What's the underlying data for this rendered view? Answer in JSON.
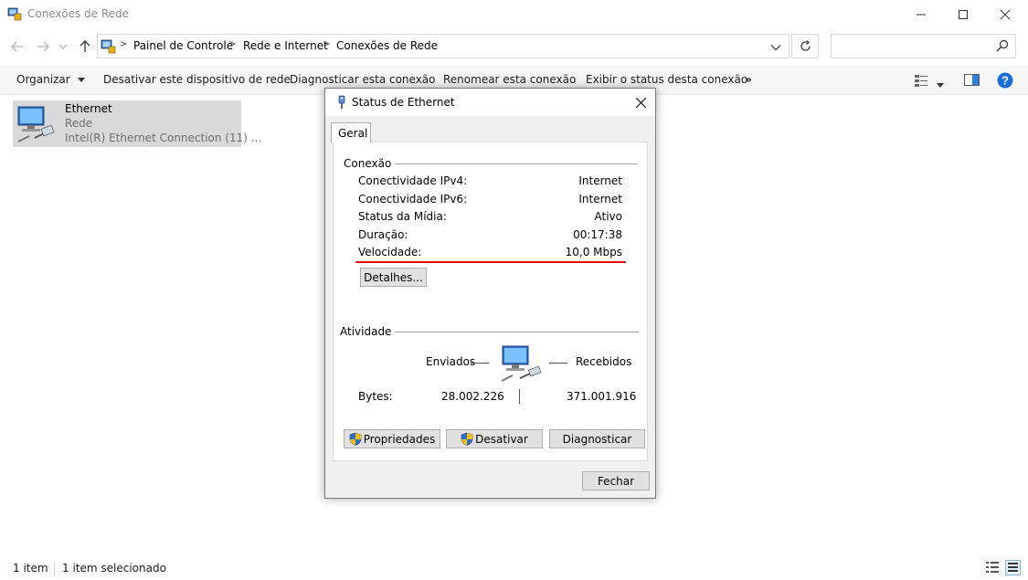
{
  "window": {
    "title": "Conexões de Rede"
  },
  "nav": {
    "breadcrumbs": [
      "Painel de Controle",
      "Rede e Internet",
      "Conexões de Rede"
    ],
    "search_placeholder": ""
  },
  "commands": {
    "organize": "Organizar",
    "disable_device": "Desativar este dispositivo de rede",
    "diagnose": "Diagnosticar esta conexão",
    "rename": "Renomear esta conexão",
    "view_status": "Exibir o status desta conexão",
    "more": "»"
  },
  "item": {
    "name": "Ethernet",
    "type": "Rede",
    "adapter": "Intel(R) Ethernet Connection (11) ..."
  },
  "status_bar": {
    "count": "1 item",
    "selected": "1 item selecionado"
  },
  "dialog": {
    "title": "Status de Ethernet",
    "tab": "Geral",
    "connection_group": "Conexão",
    "rows": [
      {
        "label": "Conectividade IPv4:",
        "value": "Internet"
      },
      {
        "label": "Conectividade IPv6:",
        "value": "Internet"
      },
      {
        "label": "Status da Mídia:",
        "value": "Ativo"
      },
      {
        "label": "Duração:",
        "value": "00:17:38"
      },
      {
        "label": "Velocidade:",
        "value": "10,0 Mbps"
      }
    ],
    "details_button": "Detalhes...",
    "activity_group": "Atividade",
    "sent_label": "Enviados",
    "received_label": "Recebidos",
    "bytes_label": "Bytes:",
    "bytes_sent": "28.002.226",
    "bytes_received": "371.001.916",
    "properties_button": "Propriedades",
    "disable_button": "Desativar",
    "diagnose_button": "Diagnosticar",
    "close_button": "Fechar"
  },
  "colors": {
    "highlight_underline": "#e00000",
    "selection": "#d9d9d9",
    "help_blue": "#1a6fd6"
  }
}
